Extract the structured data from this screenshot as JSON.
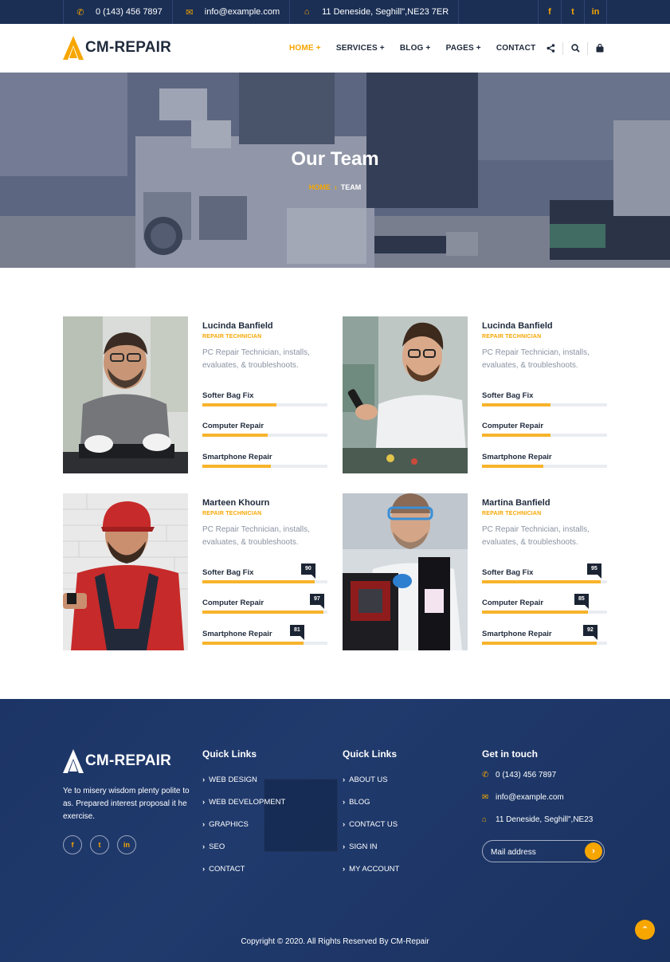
{
  "topbar": {
    "phone": "0 (143) 456 7897",
    "email": "info@example.com",
    "address": "11 Deneside, Seghill\",NE23 7ER",
    "social": [
      "f",
      "t",
      "in"
    ]
  },
  "brand": {
    "name": "CM-REPAIR",
    "accent": "#f7a600",
    "dark": "#1b2f55"
  },
  "nav": {
    "items": [
      {
        "label": "HOME +",
        "active": true
      },
      {
        "label": "SERVICES +",
        "active": false
      },
      {
        "label": "BLOG +",
        "active": false
      },
      {
        "label": "PAGES +",
        "active": false
      },
      {
        "label": "CONTACT",
        "active": false
      }
    ],
    "icons": [
      "share-icon",
      "search-icon",
      "bag-icon"
    ]
  },
  "hero": {
    "title": "Our Team",
    "crumb_home": "HOME",
    "crumb_current": "TEAM"
  },
  "team": [
    {
      "name": "Lucinda Banfield",
      "role": "REPAIR TECHNICIAN",
      "desc": "PC Repair Technician, installs, evaluates, & troubleshoots.",
      "show_values": false,
      "skills": [
        {
          "label": "Softer Bag Fix",
          "value": 59
        },
        {
          "label": "Computer Repair",
          "value": 52
        },
        {
          "label": "Smartphone Repair",
          "value": 55
        }
      ]
    },
    {
      "name": "Lucinda Banfield",
      "role": "REPAIR TECHNICIAN",
      "desc": "PC Repair Technician, installs, evaluates, & troubleshoots.",
      "show_values": false,
      "skills": [
        {
          "label": "Softer Bag Fix",
          "value": 55
        },
        {
          "label": "Computer Repair",
          "value": 55
        },
        {
          "label": "Smartphone Repair",
          "value": 49
        }
      ]
    },
    {
      "name": "Marteen Khourn",
      "role": "REPAIR TECHNICIAN",
      "desc": "PC Repair Technician, installs, evaluates, & troubleshoots.",
      "show_values": true,
      "skills": [
        {
          "label": "Softer Bag Fix",
          "value": 90
        },
        {
          "label": "Computer Repair",
          "value": 97
        },
        {
          "label": "Smartphone Repair",
          "value": 81
        }
      ]
    },
    {
      "name": "Martina Banfield",
      "role": "REPAIR TECHNICIAN",
      "desc": "PC Repair Technician, installs, evaluates, & troubleshoots.",
      "show_values": true,
      "skills": [
        {
          "label": "Softer Bag Fix",
          "value": 95
        },
        {
          "label": "Computer Repair",
          "value": 85
        },
        {
          "label": "Smartphone Repair",
          "value": 92
        }
      ]
    }
  ],
  "footer": {
    "brand": "CM-REPAIR",
    "about": "Ye to misery wisdom plenty polite to as. Prepared interest proposal it he exercise.",
    "social": [
      "f",
      "t",
      "in"
    ],
    "links1": {
      "title": "Quick Links",
      "items": [
        "WEB DESIGN",
        "WEB DEVELOPMENT",
        "GRAPHICS",
        "SEO",
        "CONTACT"
      ]
    },
    "links2": {
      "title": "Quick Links",
      "items": [
        "ABOUT US",
        "BLOG",
        "CONTACT US",
        "SIGN IN",
        "MY ACCOUNT"
      ]
    },
    "contact": {
      "title": "Get in touch",
      "phone": "0 (143) 456 7897",
      "email": "info@example.com",
      "address": "11 Deneside, Seghill\",NE23"
    },
    "mail_placeholder": "Mail address",
    "copyright": "Copyright © 2020. All Rights Reserved By CM-Repair"
  }
}
